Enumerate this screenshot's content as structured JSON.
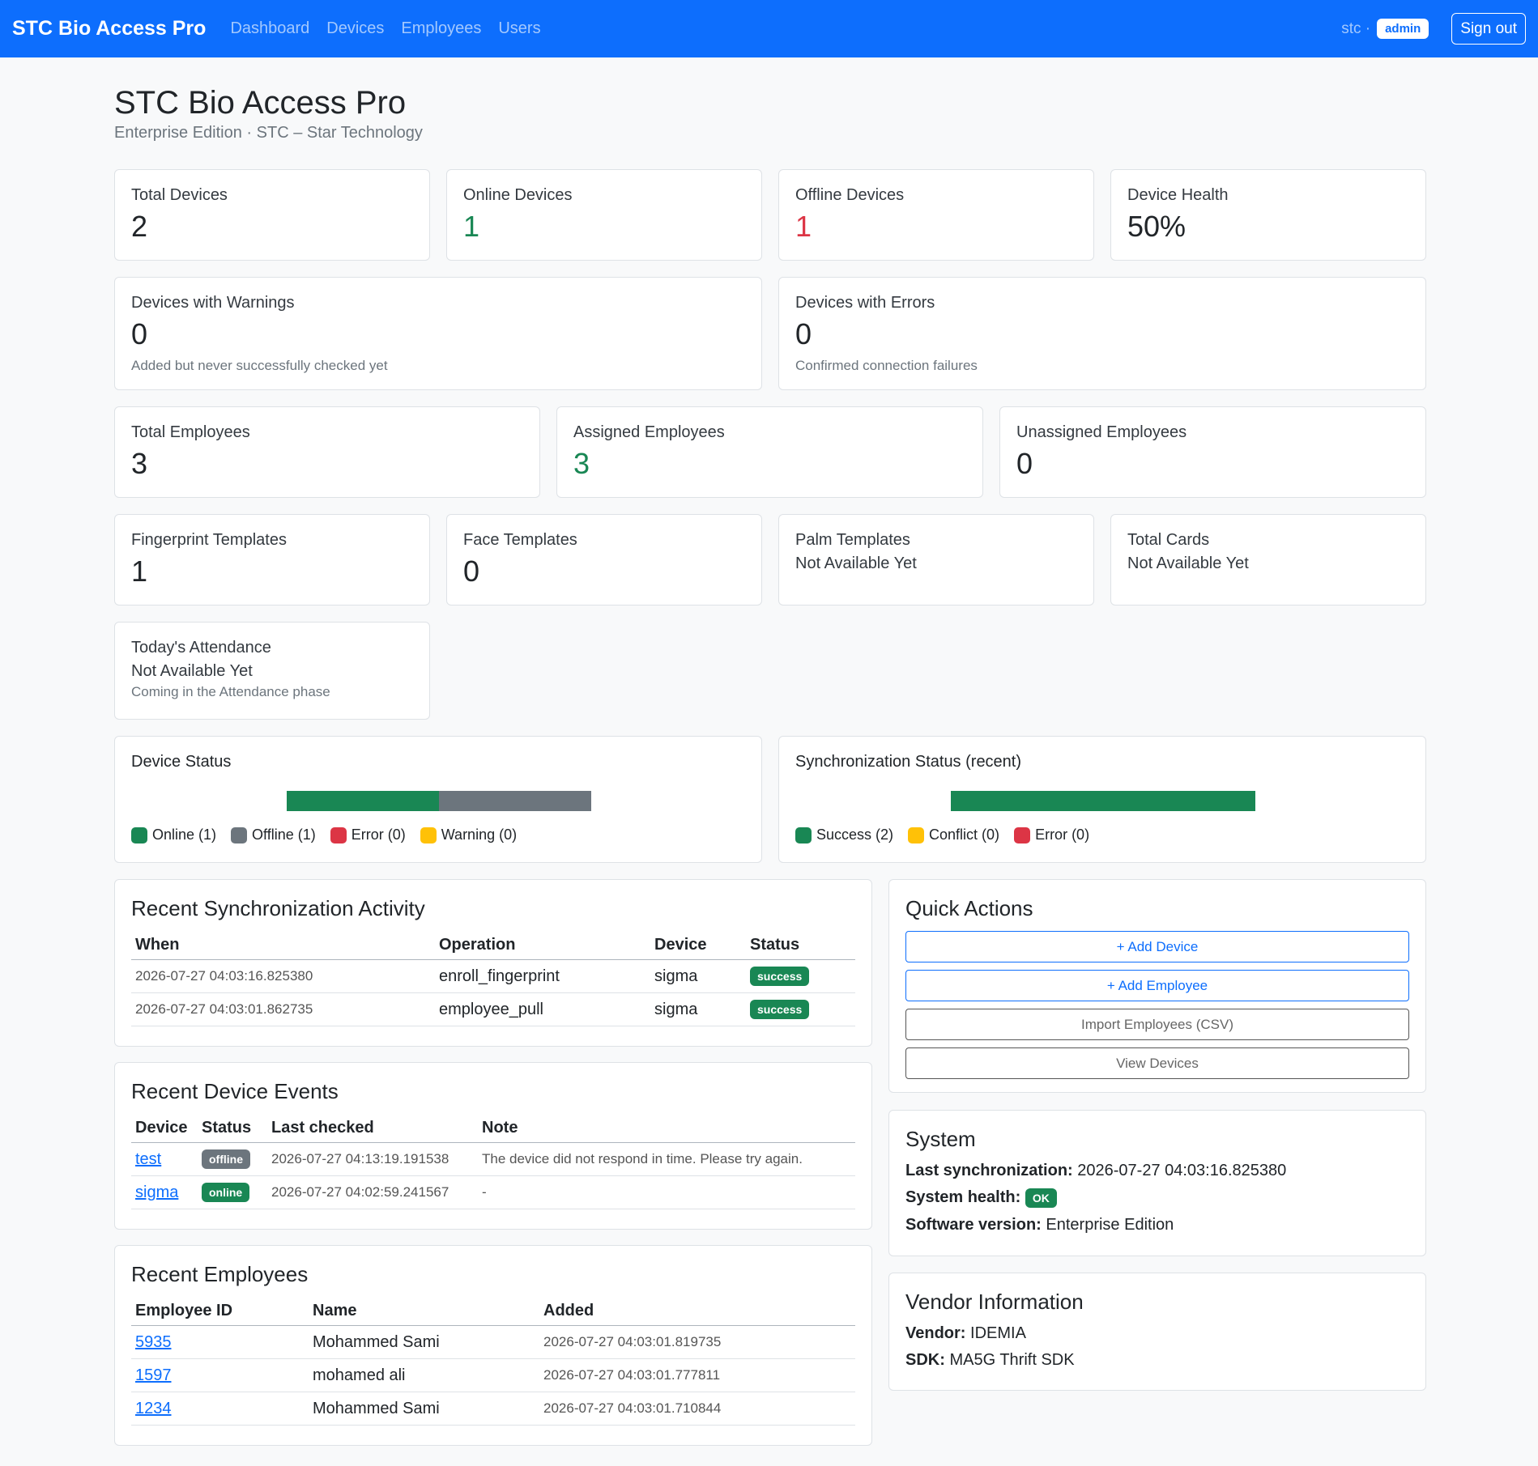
{
  "nav": {
    "brand": "STC Bio Access Pro",
    "links": [
      "Dashboard",
      "Devices",
      "Employees",
      "Users"
    ],
    "user": "stc ·",
    "role_badge": "admin",
    "signout": "Sign out"
  },
  "header": {
    "title": "STC Bio Access Pro",
    "subtitle": "Enterprise Edition · STC – Star Technology"
  },
  "stats": {
    "total_devices": {
      "label": "Total Devices",
      "value": "2"
    },
    "online_devices": {
      "label": "Online Devices",
      "value": "1"
    },
    "offline_devices": {
      "label": "Offline Devices",
      "value": "1"
    },
    "device_health": {
      "label": "Device Health",
      "value": "50%"
    },
    "warnings": {
      "label": "Devices with Warnings",
      "value": "0",
      "note": "Added but never successfully checked yet"
    },
    "errors": {
      "label": "Devices with Errors",
      "value": "0",
      "note": "Confirmed connection failures"
    },
    "total_employees": {
      "label": "Total Employees",
      "value": "3"
    },
    "assigned_employees": {
      "label": "Assigned Employees",
      "value": "3"
    },
    "unassigned_employees": {
      "label": "Unassigned Employees",
      "value": "0"
    },
    "fingerprint": {
      "label": "Fingerprint Templates",
      "value": "1"
    },
    "face": {
      "label": "Face Templates",
      "value": "0"
    },
    "palm": {
      "label": "Palm Templates",
      "value": "Not Available Yet"
    },
    "cards": {
      "label": "Total Cards",
      "value": "Not Available Yet"
    },
    "attendance": {
      "label": "Today's Attendance",
      "value": "Not Available Yet",
      "note": "Coming in the Attendance phase"
    }
  },
  "device_status": {
    "title": "Device Status",
    "bar": [
      {
        "name": "Online",
        "fraction": 0.5,
        "color": "#198754"
      },
      {
        "name": "Offline",
        "fraction": 0.5,
        "color": "#6c757d"
      }
    ],
    "legend": [
      {
        "label": "Online (1)",
        "color": "#198754"
      },
      {
        "label": "Offline (1)",
        "color": "#6c757d"
      },
      {
        "label": "Error (0)",
        "color": "#dc3545"
      },
      {
        "label": "Warning (0)",
        "color": "#ffc107"
      }
    ]
  },
  "sync_status": {
    "title": "Synchronization Status (recent)",
    "bar": [
      {
        "name": "Success",
        "fraction": 1.0,
        "color": "#198754"
      }
    ],
    "legend": [
      {
        "label": "Success (2)",
        "color": "#198754"
      },
      {
        "label": "Conflict (0)",
        "color": "#ffc107"
      },
      {
        "label": "Error (0)",
        "color": "#dc3545"
      }
    ]
  },
  "sync_activity": {
    "title": "Recent Synchronization Activity",
    "columns": [
      "When",
      "Operation",
      "Device",
      "Status"
    ],
    "rows": [
      {
        "when": "2026-07-27 04:03:16.825380",
        "operation": "enroll_fingerprint",
        "device": "sigma",
        "status": "success"
      },
      {
        "when": "2026-07-27 04:03:01.862735",
        "operation": "employee_pull",
        "device": "sigma",
        "status": "success"
      }
    ]
  },
  "device_events": {
    "title": "Recent Device Events",
    "columns": [
      "Device",
      "Status",
      "Last checked",
      "Note"
    ],
    "rows": [
      {
        "device": "test",
        "status": "offline",
        "checked": "2026-07-27 04:13:19.191538",
        "note": "The device did not respond in time. Please try again."
      },
      {
        "device": "sigma",
        "status": "online",
        "checked": "2026-07-27 04:02:59.241567",
        "note": "-"
      }
    ]
  },
  "recent_employees": {
    "title": "Recent Employees",
    "columns": [
      "Employee ID",
      "Name",
      "Added"
    ],
    "rows": [
      {
        "id": "5935",
        "name": "Mohammed Sami",
        "added": "2026-07-27 04:03:01.819735"
      },
      {
        "id": "1597",
        "name": "mohamed ali",
        "added": "2026-07-27 04:03:01.777811"
      },
      {
        "id": "1234",
        "name": "Mohammed Sami",
        "added": "2026-07-27 04:03:01.710844"
      }
    ]
  },
  "quick_actions": {
    "title": "Quick Actions",
    "add_device": "+ Add Device",
    "add_employee": "+ Add Employee",
    "import_csv": "Import Employees (CSV)",
    "view_devices": "View Devices"
  },
  "system": {
    "title": "System",
    "last_sync_label": "Last synchronization:",
    "last_sync_value": "2026-07-27 04:03:16.825380",
    "health_label": "System health:",
    "health_value": "OK",
    "version_label": "Software version:",
    "version_value": "Enterprise Edition"
  },
  "vendor": {
    "title": "Vendor Information",
    "vendor_label": "Vendor:",
    "vendor_value": "IDEMIA",
    "sdk_label": "SDK:",
    "sdk_value": "MA5G Thrift SDK"
  },
  "colors": {
    "primary": "#0d6efd",
    "success": "#198754",
    "danger": "#dc3545",
    "warning": "#ffc107",
    "secondary": "#6c757d"
  }
}
